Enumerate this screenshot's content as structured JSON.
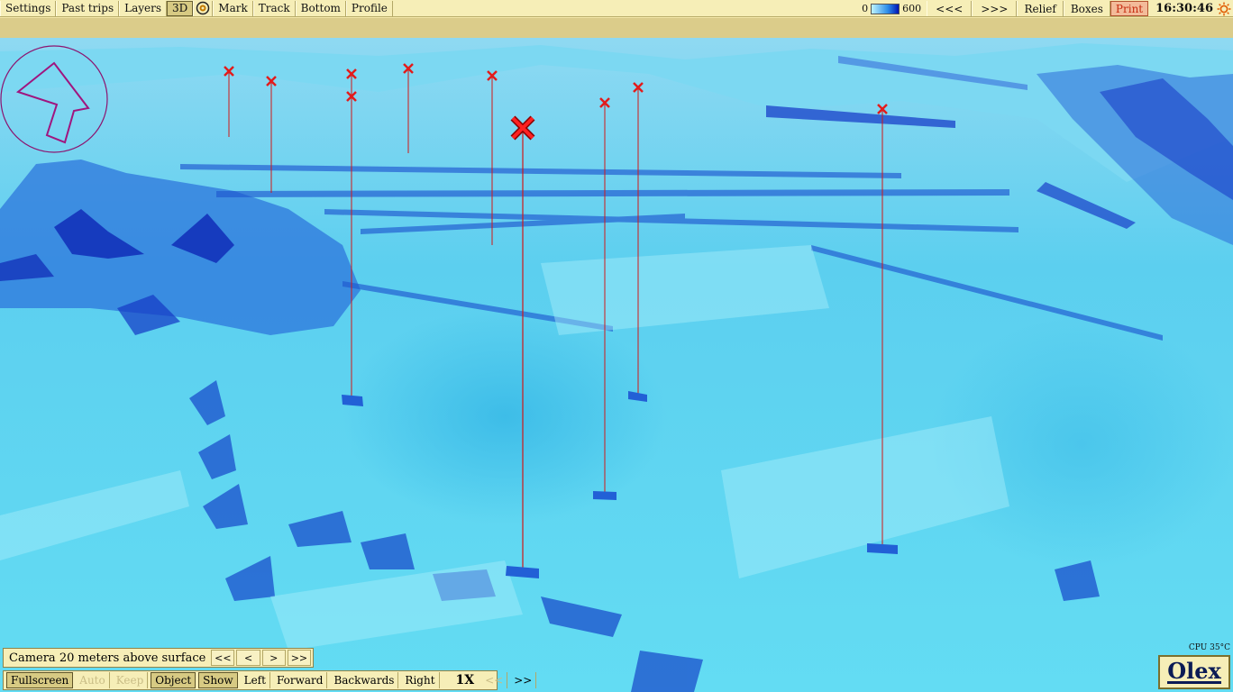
{
  "toolbar": {
    "settings": "Settings",
    "past_trips": "Past trips",
    "layers": "Layers",
    "three_d": "3D",
    "mark": "Mark",
    "track": "Track",
    "bottom": "Bottom",
    "profile": "Profile"
  },
  "depth_scale": {
    "min": "0",
    "max": "600"
  },
  "right_toolbar": {
    "prev": "<<<",
    "next": ">>>",
    "relief": "Relief",
    "boxes": "Boxes",
    "print": "Print"
  },
  "clock": "16:30:46",
  "camera": {
    "label": "Camera 20 meters above surface",
    "buttons": [
      "<<",
      "<",
      ">",
      ">>"
    ]
  },
  "nav": {
    "fullscreen": "Fullscreen",
    "auto": "Auto",
    "keep": "Keep",
    "object": "Object",
    "show": "Show",
    "left": "Left",
    "forward": "Forward",
    "backwards": "Backwards",
    "right": "Right",
    "speed": "1X",
    "slower": "<<",
    "faster": ">>"
  },
  "cpu": "CPU 35°C",
  "logo": "Olex",
  "colors": {
    "water_light": "#8fe8f7",
    "water_mid": "#3fbfe8",
    "water_deep": "#1a3fc8",
    "marker_red": "#e31b1b",
    "ui_bg": "#f6eeb7"
  },
  "markers": {
    "icon": "cross-mark",
    "count": 10
  }
}
